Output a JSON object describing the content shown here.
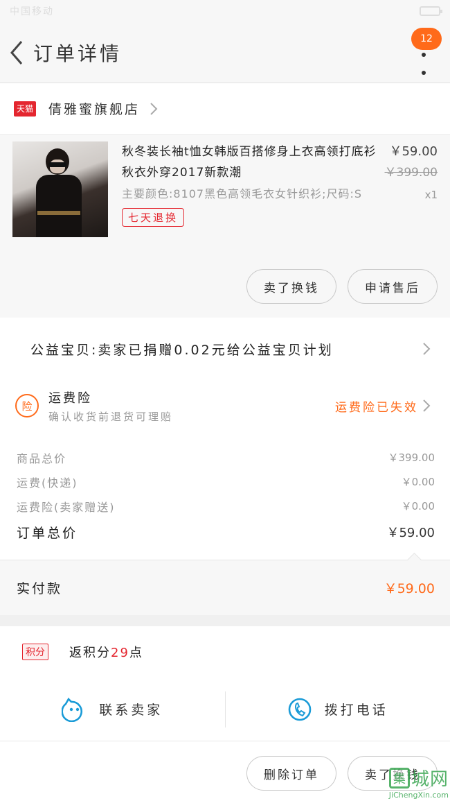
{
  "status_bar": {
    "left": "中国移动",
    "center": ""
  },
  "header": {
    "title": "订单详情",
    "badge": "12"
  },
  "shop": {
    "logo": "天猫",
    "name": "倩雅蜜旗舰店"
  },
  "product": {
    "title": "秋冬装长袖t恤女韩版百搭修身上衣高领打底衫秋衣外穿2017新款潮",
    "spec": "主要颜色:8107黑色高领毛衣女针织衫;尺码:S",
    "tag": "七天退换",
    "price": "￥59.00",
    "original_price": "￥399.00",
    "quantity": "x1"
  },
  "product_actions": {
    "refund": "卖了换钱",
    "after_sales": "申请售后"
  },
  "charity": {
    "text": "公益宝贝:卖家已捐赠0.02元给公益宝贝计划"
  },
  "insurance": {
    "icon_text": "险",
    "title": "运费险",
    "subtitle": "确认收货前退货可理赔",
    "status": "运费险已失效"
  },
  "costs": [
    {
      "label": "商品总价",
      "value": "￥399.00"
    },
    {
      "label": "运费(快递)",
      "value": "￥0.00"
    },
    {
      "label": "运费险(卖家赠送)",
      "value": "￥0.00"
    }
  ],
  "order_total": {
    "label": "订单总价",
    "value": "￥59.00"
  },
  "paid": {
    "label": "实付款",
    "value": "￥59.00"
  },
  "points": {
    "tag": "积分",
    "prefix": "返积分",
    "amount": "29",
    "suffix": "点"
  },
  "contact": {
    "seller": "联系卖家",
    "call": "拨打电话"
  },
  "footer": {
    "delete": "删除订单",
    "sell": "卖了换钱"
  },
  "watermark": {
    "box": "集",
    "cn": "城网",
    "en": "JiChengXin.com"
  },
  "colors": {
    "accent": "#ff6a1a",
    "tmall_red": "#e4262f",
    "icon_blue": "#1a9bd7"
  }
}
